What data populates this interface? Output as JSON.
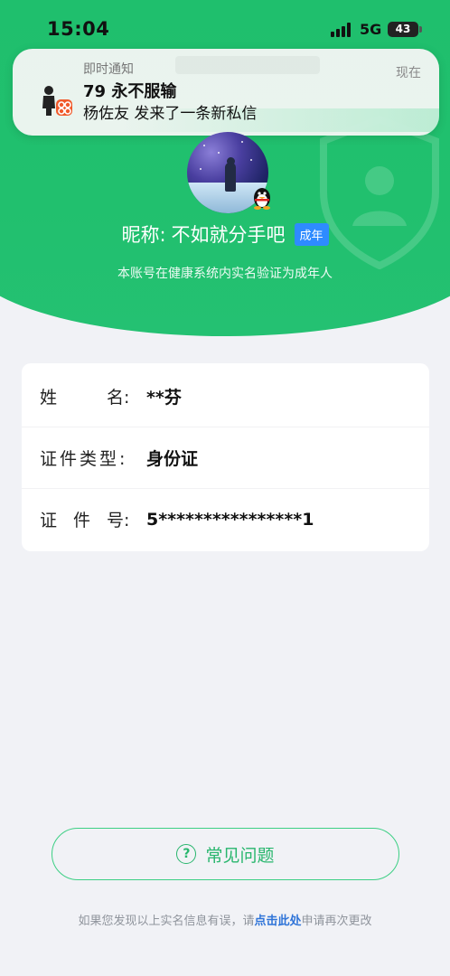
{
  "status_bar": {
    "time": "15:04",
    "network": "5G",
    "battery": "43"
  },
  "notification": {
    "label": "即时通知",
    "time": "现在",
    "title": "79 永不服输",
    "body": "杨佐友 发来了一条新私信"
  },
  "profile": {
    "nickname_label": "昵称:",
    "nickname": "不如就分手吧",
    "age_badge": "成年",
    "verify_note": "本账号在健康系统内实名验证为成年人"
  },
  "info": {
    "rows": [
      {
        "label": "姓      名:",
        "value": "**芬"
      },
      {
        "label": "证件类型:",
        "value": "身份证"
      },
      {
        "label": "证  件  号:",
        "value": "5****************1"
      }
    ]
  },
  "faq": {
    "label": "常见问题",
    "icon": "question-circle-icon"
  },
  "footer": {
    "prefix": "如果您发现以上实名信息有误，请",
    "link": "点击此处",
    "suffix": "申请再次更改"
  },
  "colors": {
    "brand_green": "#21c06e",
    "link_blue": "#2f74d8",
    "badge_blue": "#2e8bff"
  }
}
